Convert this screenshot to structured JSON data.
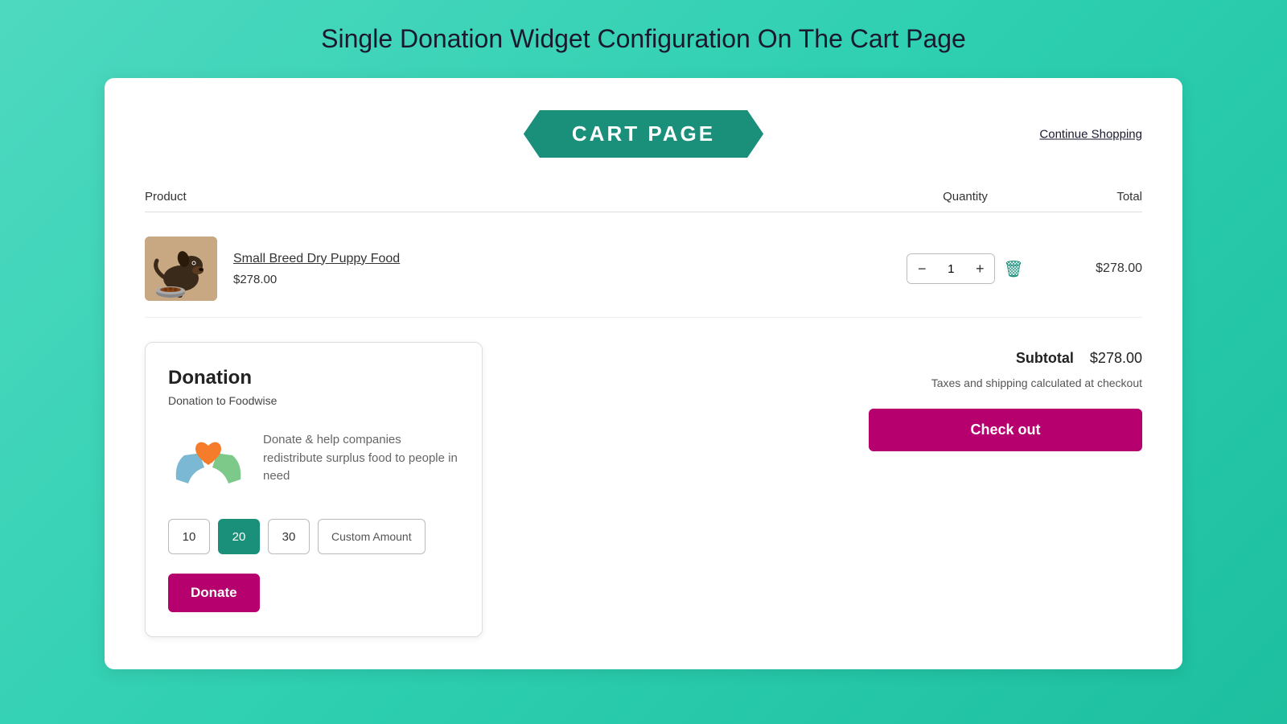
{
  "page": {
    "title": "Single Donation Widget Configuration On The Cart Page"
  },
  "header": {
    "banner_text": "CART PAGE",
    "continue_shopping": "Continue Shopping"
  },
  "table": {
    "columns": {
      "product": "Product",
      "quantity": "Quantity",
      "total": "Total"
    }
  },
  "cart_item": {
    "name": "Small Breed Dry Puppy Food",
    "price": "$278.00",
    "quantity": 1,
    "total": "$278.00"
  },
  "donation": {
    "title": "Donation",
    "subtitle": "Donation to Foodwise",
    "description": "Donate & help companies redistribute surplus food to people in need",
    "amounts": [
      {
        "value": "10",
        "label": "10",
        "active": false
      },
      {
        "value": "20",
        "label": "20",
        "active": true
      },
      {
        "value": "30",
        "label": "30",
        "active": false
      }
    ],
    "custom_amount_label": "Custom Amount",
    "donate_button": "Donate"
  },
  "checkout": {
    "subtotal_label": "Subtotal",
    "subtotal_value": "$278.00",
    "taxes_note": "Taxes and shipping calculated at checkout",
    "checkout_button": "Check out"
  }
}
